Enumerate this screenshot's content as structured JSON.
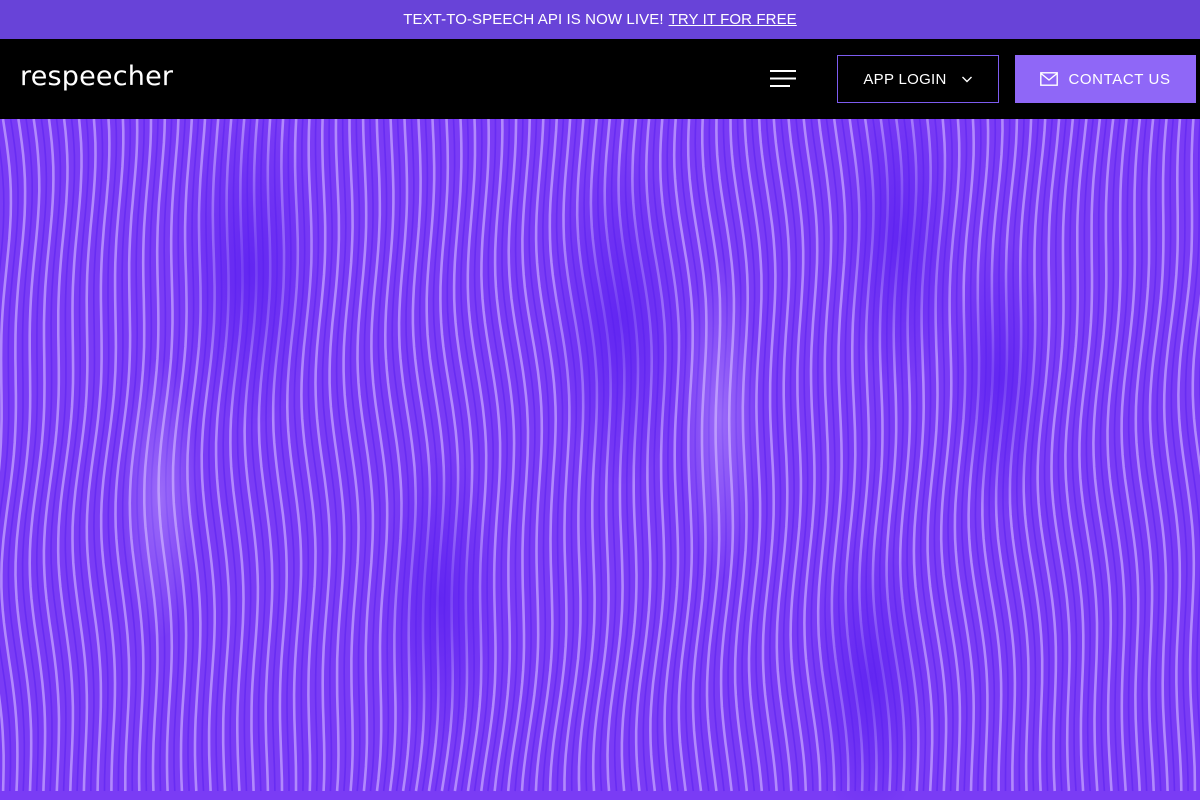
{
  "announcement": {
    "text": "TEXT-TO-SPEECH API IS NOW LIVE!",
    "link_label": "TRY IT FOR FREE"
  },
  "header": {
    "logo": "respeecher",
    "menu_icon": "hamburger-menu-icon",
    "app_login_label": "APP LOGIN",
    "app_login_icon": "chevron-down-icon",
    "contact_label": "CONTACT US",
    "contact_icon": "mail-icon"
  },
  "colors": {
    "announcement_bg": "#6843d8",
    "navbar_bg": "#000000",
    "accent": "#8f67f7",
    "hero_base": "#7a3cf5",
    "hero_light": "#c9a9ff",
    "hero_dark": "#5a1ff0"
  }
}
